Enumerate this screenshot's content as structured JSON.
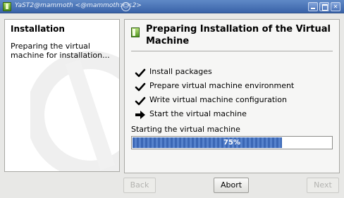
{
  "window": {
    "title": "YaST2@mammoth <@mammoth> <2>",
    "buttons": {
      "minimize": "minimize-icon",
      "maximize": "maximize-icon",
      "close": "close-icon"
    }
  },
  "help": {
    "title": "Installation",
    "text": "Preparing the virtual machine for installation..."
  },
  "main": {
    "heading": "Preparing Installation of the Virtual Machine",
    "steps": [
      {
        "label": "Install packages",
        "status": "done"
      },
      {
        "label": "Prepare virtual machine environment",
        "status": "done"
      },
      {
        "label": "Write virtual machine configuration",
        "status": "done"
      },
      {
        "label": "Start the virtual machine",
        "status": "current"
      }
    ],
    "progress": {
      "label": "Starting the virtual machine",
      "percent": 75,
      "text": "75%"
    }
  },
  "buttons": {
    "back": "Back",
    "abort": "Abort",
    "next": "Next"
  },
  "colors": {
    "titlebar": "#4a74b9",
    "progress": "#3b67b5"
  }
}
